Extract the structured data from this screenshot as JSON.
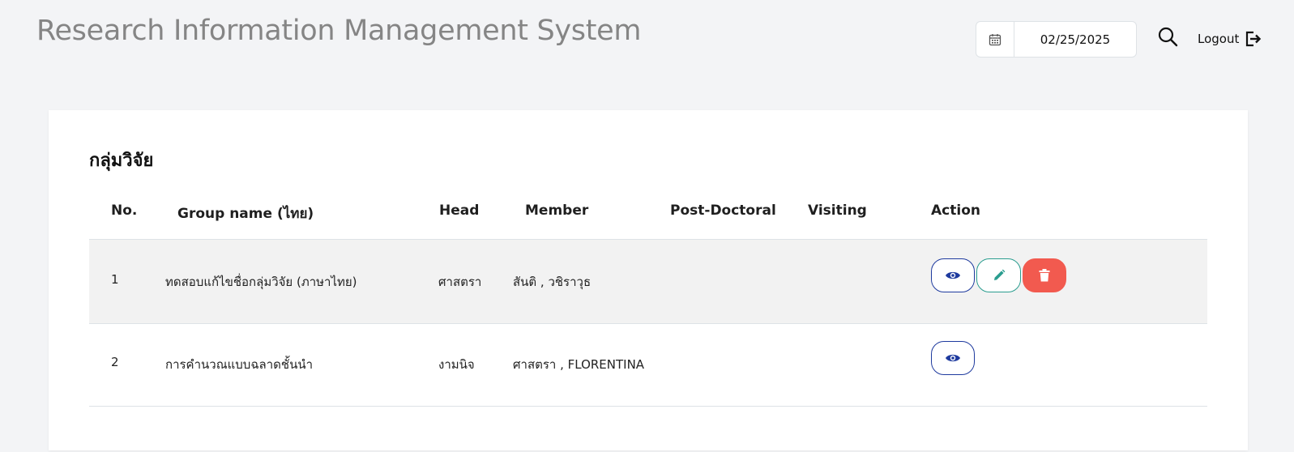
{
  "header": {
    "title": "Research Information Management System",
    "date_value": "02/25/2025",
    "logout_label": "Logout",
    "icons": {
      "calendar": "calendar-icon",
      "search": "search-icon",
      "logout": "logout-icon"
    }
  },
  "page": {
    "title": "กลุ่มวิจัย"
  },
  "table": {
    "columns": [
      "No.",
      "Group name (ไทย)",
      "Head",
      "Member",
      "Post-Doctoral",
      "Visiting",
      "Action"
    ],
    "rows": [
      {
        "no": "1",
        "group_name": "ทดสอบแก้ไขชื่อกลุ่มวิจัย (ภาษาไทย)",
        "head": "ศาสตรา",
        "member": "สันติ , วชิราวุธ",
        "post_doctoral": "",
        "visiting": "",
        "actions": [
          "view",
          "edit",
          "delete"
        ]
      },
      {
        "no": "2",
        "group_name": "การคำนวณแบบฉลาดชั้นนำ",
        "head": "งามนิจ",
        "member": "ศาสตรา , FLORENTINA",
        "post_doctoral": "",
        "visiting": "",
        "actions": [
          "view"
        ]
      }
    ]
  },
  "colors": {
    "view": "#1e3a9e",
    "edit": "#2a9d8f",
    "delete": "#f25a4f",
    "row_shade": "#f2f2f2"
  }
}
